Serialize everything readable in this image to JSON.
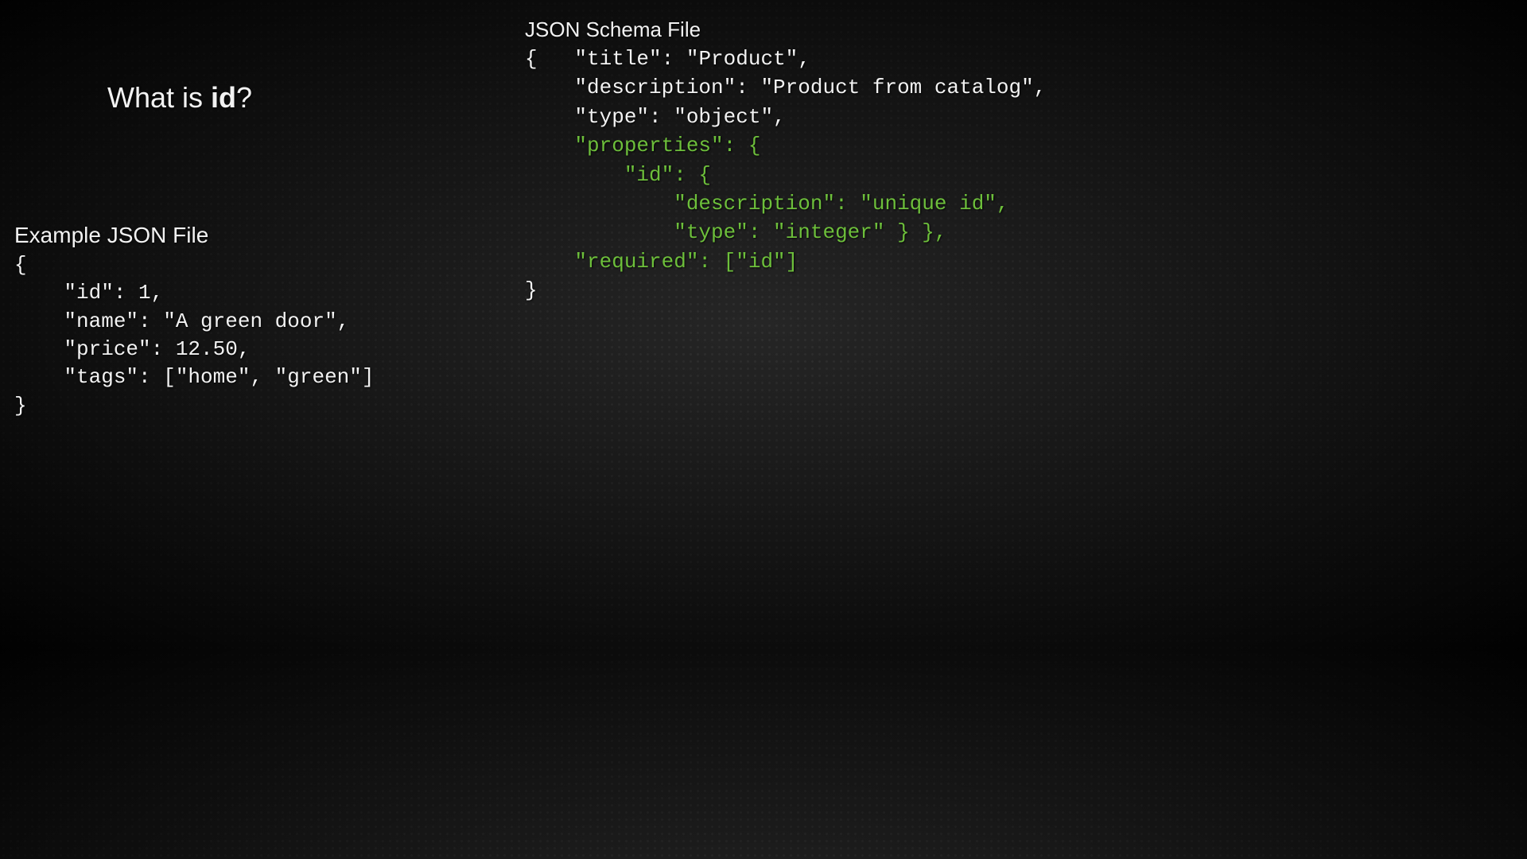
{
  "slide": {
    "title_prefix": "What is ",
    "title_bold": "id",
    "title_suffix": "?"
  },
  "example": {
    "heading": "Example JSON File",
    "lines": {
      "l0": "{",
      "l1": "    \"id\": 1,",
      "l2": "    \"name\": \"A green door\",",
      "l3": "    \"price\": 12.50,",
      "l4": "    \"tags\": [\"home\", \"green\"]",
      "l5": "}"
    }
  },
  "schema": {
    "heading": "JSON Schema File",
    "lines": {
      "l0a": "{   ",
      "l0b": "\"title\": \"Product\",",
      "l1": "    \"description\": \"Product from catalog\",",
      "l2": "    \"type\": \"object\",",
      "l3": "    \"properties\": {",
      "l4": "        \"id\": {",
      "l5": "            \"description\": \"unique id\",",
      "l6": "            \"type\": \"integer\" } },",
      "l7": "    \"required\": [\"id\"]",
      "l8": "}"
    }
  }
}
